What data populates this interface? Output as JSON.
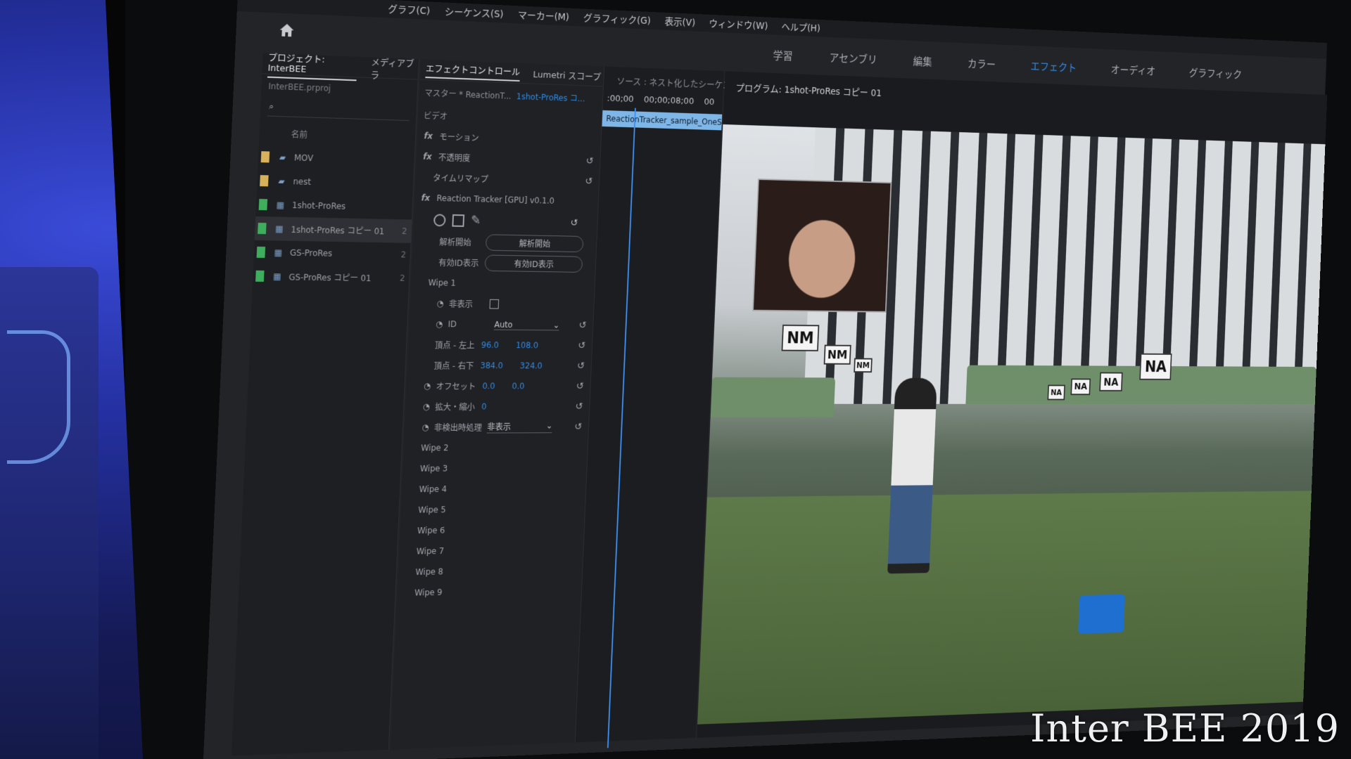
{
  "menu": [
    "グラフ(C)",
    "シーケンス(S)",
    "マーカー(M)",
    "グラフィック(G)",
    "表示(V)",
    "ウィンドウ(W)",
    "ヘルプ(H)"
  ],
  "workspaces": [
    {
      "label": "学習",
      "active": false
    },
    {
      "label": "アセンブリ",
      "active": false
    },
    {
      "label": "編集",
      "active": false
    },
    {
      "label": "カラー",
      "active": false
    },
    {
      "label": "エフェクト",
      "active": true
    },
    {
      "label": "オーディオ",
      "active": false
    },
    {
      "label": "グラフィック",
      "active": false
    }
  ],
  "project": {
    "tab_active": "プロジェクト: InterBEE",
    "tab_other": "メディアブラ",
    "file": "InterBEE.prproj",
    "column_name": "名前",
    "items": [
      {
        "name": "MOV",
        "type": "folder",
        "color": "#d8b25a",
        "count": ""
      },
      {
        "name": "nest",
        "type": "folder",
        "color": "#d8b25a",
        "count": ""
      },
      {
        "name": "1shot-ProRes",
        "type": "sequence",
        "color": "#3fae5c",
        "count": ""
      },
      {
        "name": "1shot-ProRes コピー 01",
        "type": "sequence",
        "color": "#3fae5c",
        "count": "2"
      },
      {
        "name": "GS-ProRes",
        "type": "sequence",
        "color": "#3fae5c",
        "count": "2"
      },
      {
        "name": "GS-ProRes コピー 01",
        "type": "sequence",
        "color": "#3fae5c",
        "count": "2"
      }
    ]
  },
  "effect_controls": {
    "tab": "エフェクトコントロール",
    "tab_other": "Lumetri スコープ",
    "master": "マスター * ReactionT...",
    "clip": "1shot-ProRes コ...",
    "section_video": "ビデオ",
    "fx": {
      "motion": "モーション",
      "opacity": "不透明度",
      "timeremap": "タイムリマップ",
      "plugin": "Reaction Tracker [GPU] v0.1.0"
    },
    "analyze_label": "解析開始",
    "analyze_button": "解析開始",
    "valid_id_label": "有効ID表示",
    "valid_id_button": "有効ID表示",
    "wipe1": "Wipe 1",
    "hide_label": "非表示",
    "id_label": "ID",
    "id_value": "Auto",
    "top_left_label": "頂点 - 左上",
    "top_left_x": "96.0",
    "top_left_y": "108.0",
    "bottom_right_label": "頂点 - 右下",
    "bottom_right_x": "384.0",
    "bottom_right_y": "324.0",
    "offset_label": "オフセット",
    "offset_x": "0.0",
    "offset_y": "0.0",
    "scale_label": "拡大・縮小",
    "scale_value": "0",
    "nondetect_label": "非検出時処理",
    "nondetect_value": "非表示",
    "wipes": [
      "Wipe 2",
      "Wipe 3",
      "Wipe 4",
      "Wipe 5",
      "Wipe 6",
      "Wipe 7",
      "Wipe 8",
      "Wipe 9"
    ]
  },
  "timeline": {
    "source_tab": "ソース : ネスト化したシーケンス",
    "tc_start": ":00;00",
    "tc_mid": "00;00;08;00",
    "tc_end": "00",
    "clip": "ReactionTracker_sample_OneShot"
  },
  "program": {
    "tab": "プログラム: 1shot-ProRes コピー 01"
  },
  "video_signs": [
    "NM",
    "NM",
    "NM",
    "NA",
    "NA",
    "NA",
    "NA"
  ],
  "watermark": "Inter BEE 2019",
  "colors": {
    "accent": "#2d8ceb",
    "panel": "#202124",
    "clip": "#7fb6e8"
  }
}
